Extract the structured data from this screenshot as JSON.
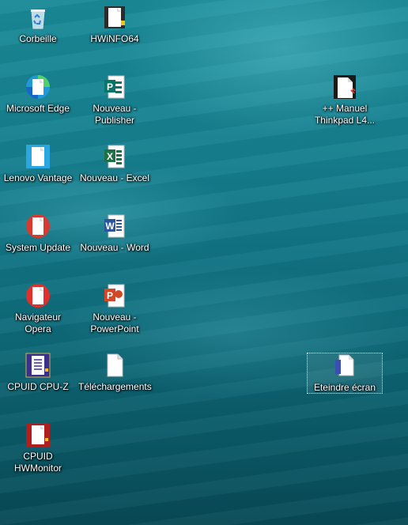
{
  "desktop": {
    "icons": [
      {
        "label": "Corbeille",
        "icon": "recycle-bin-icon"
      },
      {
        "label": "Microsoft Edge",
        "icon": "edge-icon"
      },
      {
        "label": "Lenovo Vantage",
        "icon": "lenovo-vantage-icon"
      },
      {
        "label": "System Update",
        "icon": "system-update-icon"
      },
      {
        "label": "Navigateur Opera",
        "icon": "opera-icon"
      },
      {
        "label": "CPUID CPU-Z",
        "icon": "cpuz-icon"
      },
      {
        "label": "CPUID\nHWMonitor",
        "icon": "hwmonitor-icon"
      },
      {
        "label": "HWiNFO64",
        "icon": "hwinfo-icon"
      },
      {
        "label": "Nouveau -\nPublisher",
        "icon": "publisher-icon"
      },
      {
        "label": "Nouveau - Excel",
        "icon": "excel-icon"
      },
      {
        "label": "Nouveau - Word",
        "icon": "word-icon"
      },
      {
        "label": "Nouveau -\nPowerPoint",
        "icon": "powerpoint-icon"
      },
      {
        "label": "Téléchargements",
        "icon": "shortcut-file-icon"
      },
      {
        "label": "++ Manuel\nThinkpad L4...",
        "icon": "pdf-manual-icon"
      },
      {
        "label": "Eteindre écran",
        "icon": "shutdown-screen-icon"
      }
    ],
    "colors": {
      "publisher": "#077568",
      "excel": "#1e7145",
      "word": "#2b579a",
      "powerpoint": "#d24726",
      "opera": "#e0302e",
      "cpuz": "#3a2f8a",
      "hwmonitor": "#b01e1e"
    }
  }
}
